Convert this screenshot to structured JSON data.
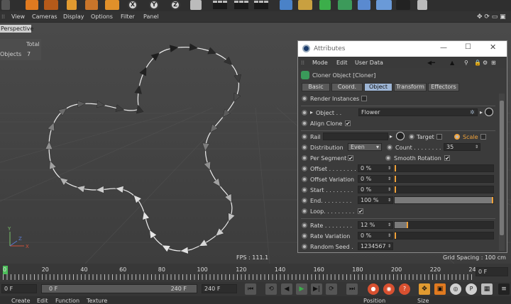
{
  "view_menu": {
    "items": [
      "View",
      "Cameras",
      "Display",
      "Options",
      "Filter",
      "Panel"
    ]
  },
  "viewport": {
    "label": "Perspective",
    "stats_total_header": "Total",
    "stats_objects_label": "Objects",
    "stats_objects_value": "7",
    "fps": "FPS : 111.1",
    "grid_spacing": "Grid Spacing : 100 cm",
    "axes": {
      "y": "Y",
      "x": "X",
      "z": "Z"
    }
  },
  "attributes": {
    "window_title": "Attributes",
    "menu": [
      "Mode",
      "Edit",
      "User Data"
    ],
    "object_header": "Cloner Object [Cloner]",
    "tabs": [
      "Basic",
      "Coord.",
      "Object",
      "Transform",
      "Effectors"
    ],
    "active_tab": "Object",
    "render_instances_label": "Render Instances",
    "object_label": "Object . .",
    "object_value": "Flower",
    "align_clone_label": "Align Clone",
    "rail_label": "Rail",
    "target_label": "Target",
    "scale_label": "Scale",
    "distribution_label": "Distribution",
    "distribution_value": "Even",
    "count_label": "Count . . . . . . . .",
    "count_value": "35",
    "per_segment_label": "Per Segment",
    "smooth_rotation_label": "Smooth Rotation",
    "sliders": [
      {
        "label": "Offset . . . . . . . .",
        "value": "0 %",
        "fraction": 0.0
      },
      {
        "label": "Offset Variation",
        "value": "0 %",
        "fraction": 0.0
      },
      {
        "label": "Start . . . . . . . .",
        "value": "0 %",
        "fraction": 0.0
      },
      {
        "label": "End. . . . . . . . .",
        "value": "100 %",
        "fraction": 1.0
      }
    ],
    "loop_label": "Loop. . . . . . . . .",
    "rate_label": "Rate . . . . . . . .",
    "rate_value": "12 %",
    "rate_fraction": 0.12,
    "rate_variation_label": "Rate Variation",
    "rate_variation_value": "0 %",
    "random_seed_label": "Random Seed .",
    "random_seed_value": "1234567"
  },
  "timeline": {
    "ticks": [
      "0",
      "20",
      "40",
      "60",
      "80",
      "100",
      "120",
      "140",
      "160",
      "180",
      "200",
      "220",
      "24"
    ],
    "current_frame": "0 F"
  },
  "transport": {
    "start_frame": "0 F",
    "range_start": "0 F",
    "range_end": "240 F",
    "end_frame": "240 F"
  },
  "bottom_menu": {
    "items": [
      "Create",
      "Edit",
      "Function",
      "Texture"
    ],
    "right_items": [
      "Position",
      "Size"
    ]
  },
  "colors": {
    "accent_orange": "#f0a23a",
    "tab_active": "#9eb6d6",
    "record_red": "#d85030"
  }
}
